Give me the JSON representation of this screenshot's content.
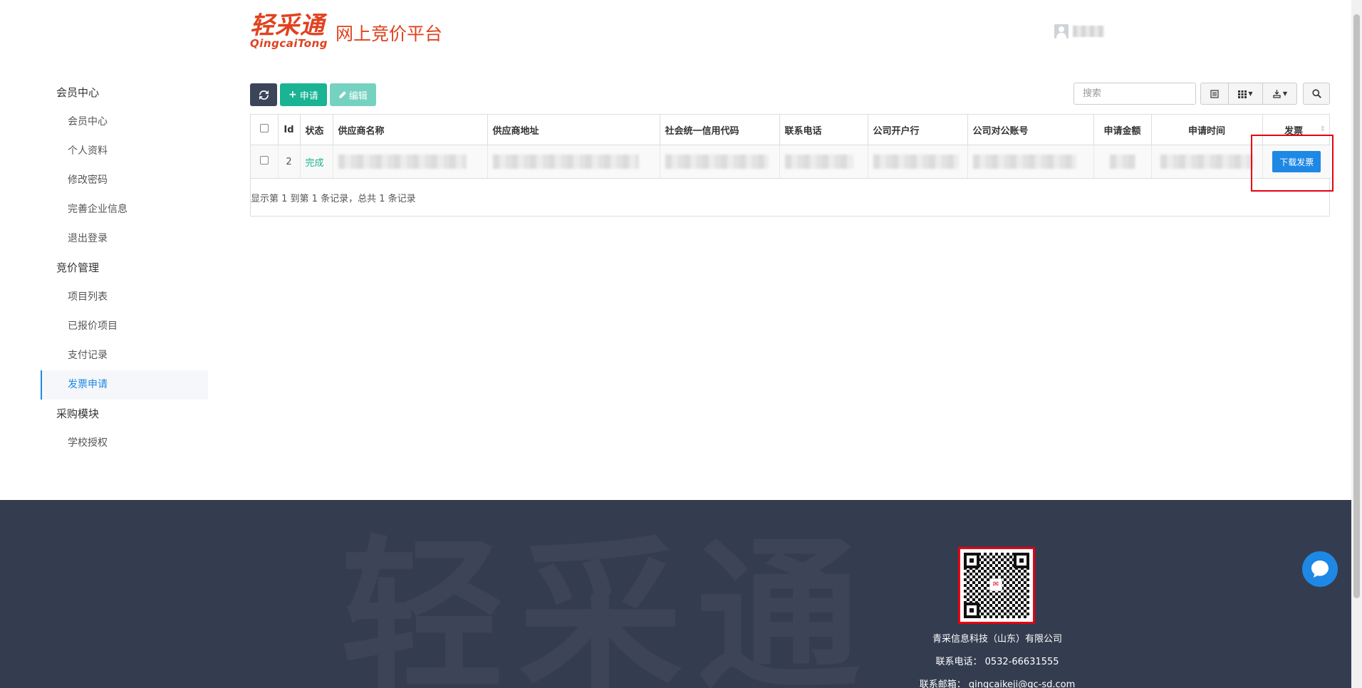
{
  "header": {
    "logo_cn": "轻采通",
    "logo_en": "QingcaiTong",
    "platform_title": "网上竞价平台",
    "username": "用户"
  },
  "sidebar": {
    "groups": [
      {
        "title": "会员中心",
        "items": [
          "会员中心",
          "个人资料",
          "修改密码",
          "完善企业信息",
          "退出登录"
        ]
      },
      {
        "title": "竞价管理",
        "items": [
          "项目列表",
          "已报价项目",
          "支付记录",
          "发票申请"
        ]
      },
      {
        "title": "采购模块",
        "items": [
          "学校授权"
        ]
      }
    ],
    "active_item": "发票申请"
  },
  "toolbar": {
    "refresh_icon": "refresh-icon",
    "apply_label": "申请",
    "edit_label": "编辑",
    "search_placeholder": "搜索"
  },
  "table": {
    "columns": [
      "Id",
      "状态",
      "供应商名称",
      "供应商地址",
      "社会统一信用代码",
      "联系电话",
      "公司开户行",
      "公司对公账号",
      "申请金额",
      "申请时间",
      "发票"
    ],
    "rows": [
      {
        "id": "2",
        "status": "完成",
        "action": "下载发票"
      }
    ],
    "pagination_text": "显示第 1 到第 1 条记录，总共 1 条记录"
  },
  "footer": {
    "watermark": "轻采通",
    "company": "青采信息科技（山东）有限公司",
    "phone": "联系电话：  0532-66631555",
    "email": "联系邮箱：  qingcaikeji@qc-sd.com"
  },
  "colors": {
    "brand": "#e0421f",
    "primary": "#1e88e5",
    "success": "#1ab394",
    "footer_bg": "#343d50",
    "highlight": "#e60012"
  }
}
